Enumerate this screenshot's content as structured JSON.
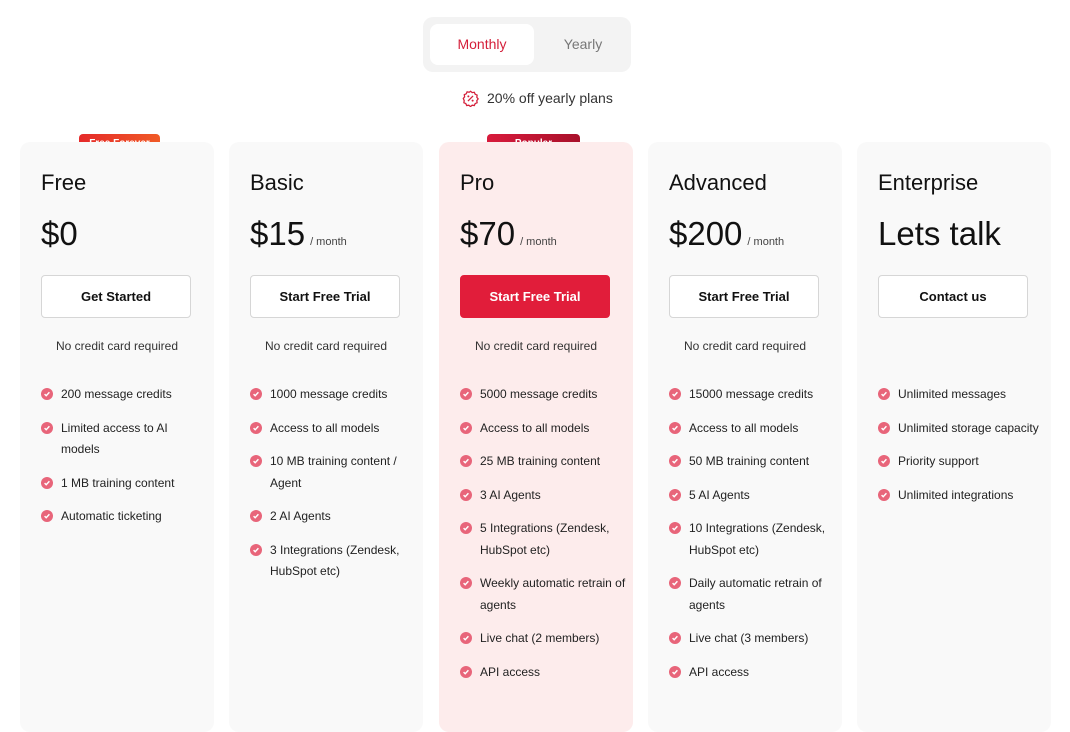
{
  "billing_toggle": {
    "monthly_label": "Monthly",
    "yearly_label": "Yearly",
    "selected": "Monthly"
  },
  "discount_note": "20% off yearly plans",
  "colors": {
    "accent": "#e11d3a",
    "check": "#e8657a",
    "pro_card_bg": "#fdecec",
    "card_bg": "#f9f9f9"
  },
  "plans": [
    {
      "badge": "Free Forever",
      "name": "Free",
      "price": "$0",
      "period": "",
      "cta": "Get Started",
      "note": "No credit card required",
      "features": [
        "200 message credits",
        "Limited access to AI models",
        "1 MB training content",
        "Automatic ticketing"
      ]
    },
    {
      "badge": "",
      "name": "Basic",
      "price": "$15",
      "period": "/ month",
      "cta": "Start Free Trial",
      "note": "No credit card required",
      "features": [
        "1000 message credits",
        "Access to all models",
        "10 MB training content / Agent",
        "2 AI Agents",
        "3 Integrations (Zendesk, HubSpot etc)"
      ]
    },
    {
      "badge": "Popular",
      "name": "Pro",
      "price": "$70",
      "period": "/ month",
      "cta": "Start Free Trial",
      "note": "No credit card required",
      "features": [
        "5000 message credits",
        "Access to all models",
        "25 MB training content",
        "3 AI Agents",
        "5 Integrations (Zendesk, HubSpot etc)",
        "Weekly automatic retrain of agents",
        "Live chat (2 members)",
        "API access"
      ]
    },
    {
      "badge": "",
      "name": "Advanced",
      "price": "$200",
      "period": "/ month",
      "cta": "Start Free Trial",
      "note": "No credit card required",
      "features": [
        "15000 message credits",
        "Access to all models",
        "50 MB training content",
        "5 AI Agents",
        "10 Integrations (Zendesk, HubSpot etc)",
        "Daily automatic retrain of agents",
        "Live chat (3 members)",
        "API access"
      ]
    },
    {
      "badge": "",
      "name": "Enterprise",
      "price": "Lets talk",
      "period": "",
      "cta": "Contact us",
      "note": "",
      "features": [
        "Unlimited messages",
        "Unlimited storage capacity",
        "Priority support",
        "Unlimited integrations"
      ]
    }
  ]
}
